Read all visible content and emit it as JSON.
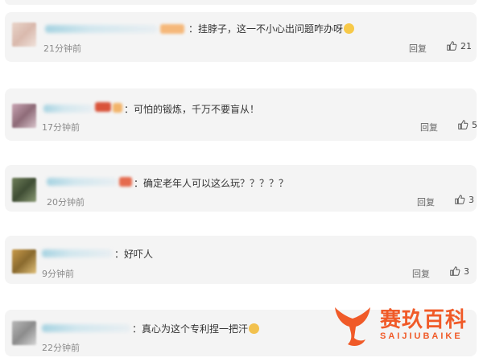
{
  "comments": [
    {
      "text": "：挂脖子，这一不小心出问题咋办呀",
      "time": "21分钟前",
      "reply": "回复",
      "likes": "21"
    },
    {
      "text": "：可怕的锻炼，千万不要盲从！",
      "time": "17分钟前",
      "reply": "回复",
      "likes": "5"
    },
    {
      "text": "：确定老年人可以这么玩？？？？？",
      "time": "20分钟前",
      "reply": "回复",
      "likes": "3"
    },
    {
      "text": "：好吓人",
      "time": "9分钟前",
      "reply": "回复",
      "likes": "3"
    },
    {
      "text": "：真心为这个专利捏一把汗",
      "time": "22分钟前",
      "reply": "",
      "likes": ""
    }
  ],
  "watermark": {
    "title": "赛玖百科",
    "subtitle": "SAIJIUBAIKE"
  },
  "colors": {
    "accent": "#f05a28",
    "card_bg": "#f4f4f4"
  }
}
